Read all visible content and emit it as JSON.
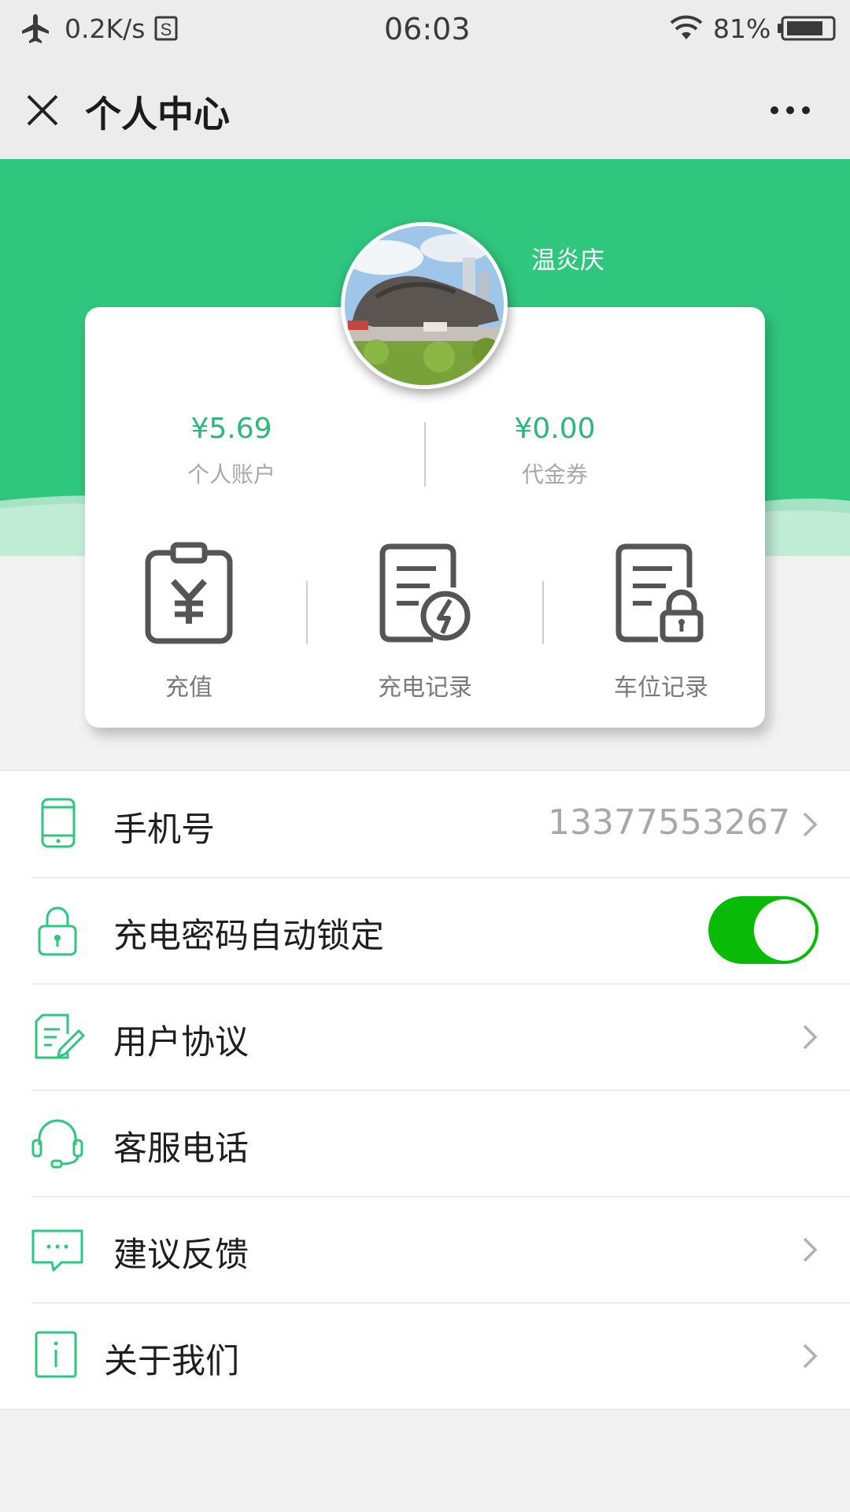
{
  "status_bar": {
    "speed": "0.2K/s",
    "time": "06:03",
    "battery_percent": "81%",
    "battery_level": 0.81,
    "icons": [
      "airplane-icon",
      "sim-icon",
      "wifi-icon",
      "battery-icon"
    ]
  },
  "title_bar": {
    "title": "个人中心",
    "close_icon": "close-icon",
    "more_icon": "more-icon"
  },
  "profile": {
    "username": "温炎庆"
  },
  "card": {
    "balances": [
      {
        "amount": "¥5.69",
        "label": "个人账户"
      },
      {
        "amount": "¥0.00",
        "label": "代金券"
      }
    ],
    "actions": [
      {
        "label": "充值",
        "icon": "recharge-clipboard-icon"
      },
      {
        "label": "充电记录",
        "icon": "charging-record-icon"
      },
      {
        "label": "车位记录",
        "icon": "parking-record-icon"
      }
    ]
  },
  "menu": {
    "phone": {
      "label": "手机号",
      "value": "13377553267",
      "icon": "phone-icon"
    },
    "lock": {
      "label": "充电密码自动锁定",
      "toggle_on": true,
      "icon": "lock-icon"
    },
    "agreement": {
      "label": "用户协议",
      "icon": "document-edit-icon"
    },
    "service": {
      "label": "客服电话",
      "icon": "headset-icon"
    },
    "feedback": {
      "label": "建议反馈",
      "icon": "chat-bubble-icon"
    },
    "about": {
      "label": "关于我们",
      "icon": "info-icon"
    }
  },
  "colors": {
    "brand_green": "#2fc67e",
    "amount_green": "#2fb67a",
    "toggle_green": "#09bb07"
  }
}
